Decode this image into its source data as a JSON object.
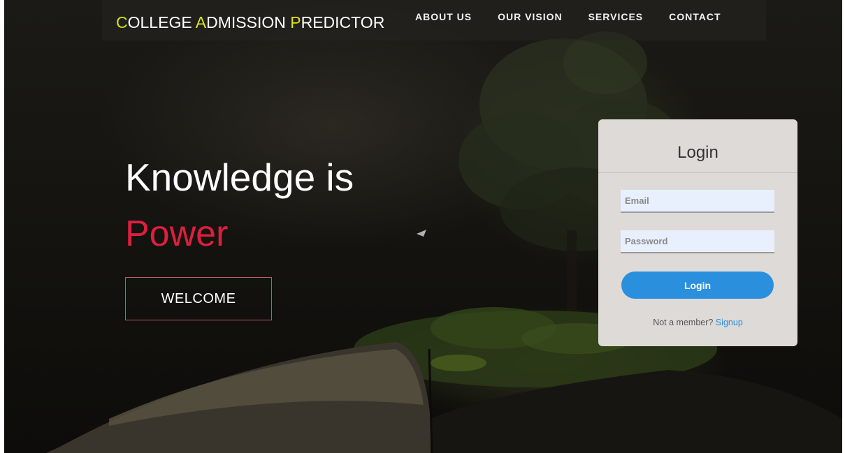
{
  "nav": {
    "brand_parts": [
      {
        "initial": "C",
        "rest": "OLLEGE "
      },
      {
        "initial": "A",
        "rest": "DMISSION "
      },
      {
        "initial": "P",
        "rest": "REDICTOR"
      }
    ],
    "links": [
      "ABOUT US",
      "OUR VISION",
      "SERVICES",
      "CONTACT"
    ]
  },
  "hero": {
    "line1": "Knowledge is",
    "line2": "Power",
    "button_label": "WELCOME"
  },
  "login": {
    "title": "Login",
    "email_placeholder": "Email",
    "password_placeholder": "Password",
    "button_label": "Login",
    "signup_prompt": "Not a member?",
    "signup_link": "Signup"
  },
  "colors": {
    "brand_highlight": "#d8e21c",
    "power_red": "#dc1f3e",
    "login_button": "#2a8fdc",
    "card_background": "#dedad7"
  }
}
